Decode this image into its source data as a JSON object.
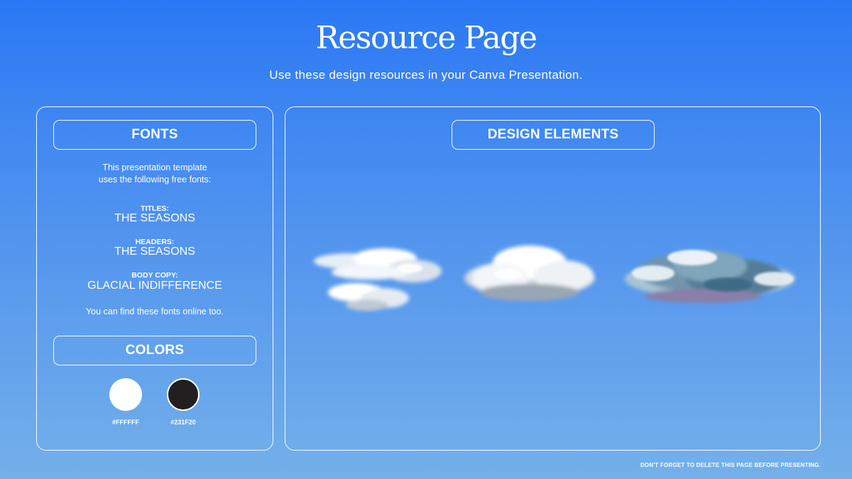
{
  "page": {
    "title": "Resource Page",
    "subtitle": "Use these design resources in your Canva Presentation.",
    "footer_note": "DON'T FORGET TO DELETE THIS PAGE BEFORE PRESENTING."
  },
  "fonts_panel": {
    "header": "FONTS",
    "intro_line_1": "This presentation template",
    "intro_line_2": "uses the following free fonts:",
    "entries": [
      {
        "label": "TITLES:",
        "font": "THE SEASONS"
      },
      {
        "label": "HEADERS:",
        "font": "THE SEASONS"
      },
      {
        "label": "BODY COPY:",
        "font": "GLACIAL INDIFFERENCE"
      }
    ],
    "note": "You can find these fonts online too."
  },
  "colors_panel": {
    "header": "COLORS",
    "swatches": [
      {
        "hex": "#FFFFFF",
        "label": "#FFFFFF"
      },
      {
        "hex": "#231F20",
        "label": "#231F20"
      }
    ]
  },
  "design_elements_panel": {
    "header": "DESIGN ELEMENTS",
    "elements": [
      {
        "icon": "wispy-cloud-icon"
      },
      {
        "icon": "fluffy-cloud-icon"
      },
      {
        "icon": "storm-cloud-icon"
      }
    ]
  },
  "colors": {
    "background_top": "#2a78f5",
    "background_bottom": "#74b0ea",
    "text": "#ffffff"
  }
}
